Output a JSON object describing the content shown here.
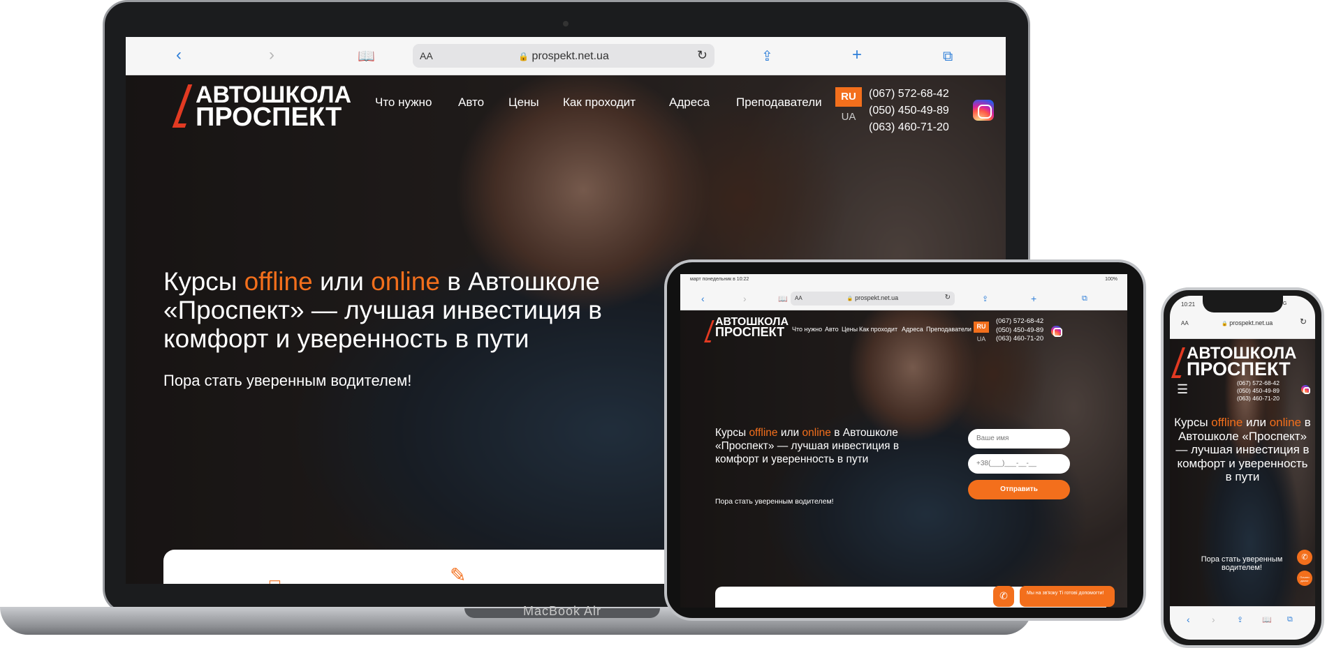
{
  "laptop": {
    "model_label": "MacBook Air",
    "browser": {
      "url": "prospekt.net.ua",
      "aa": "AA",
      "icons": [
        "back-icon",
        "forward-icon",
        "bookmarks-icon",
        "share-icon",
        "new-tab-icon",
        "tabs-icon",
        "reload-icon",
        "lock-icon"
      ]
    },
    "site": {
      "logo_line1": "АВТОШКОЛА",
      "logo_line2": "ПРОСПЕКТ",
      "nav": [
        "Что нужно",
        "Авто",
        "Цены",
        "Как проходит",
        "Адреса",
        "Преподаватели"
      ],
      "lang_active": "RU",
      "lang_other": "UA",
      "phones": [
        "(067) 572-68-42",
        "(050) 450-49-89",
        "(063) 460-71-20"
      ],
      "hero": {
        "t1": "Курсы ",
        "t2": "offline",
        "t3": " или ",
        "t4": "online",
        "t5": " в Автошколе «Проспект» — лучшая инвестиция в комфорт и уверенность в пути",
        "subtitle": "Пора стать уверенным водителем!"
      }
    }
  },
  "tablet": {
    "status_time": "март понедельник в 10:22",
    "status_right": "100%",
    "url": "prospekt.net.ua",
    "aa": "AA",
    "form": {
      "name_placeholder": "Ваше имя",
      "phone_placeholder": "+38(___)___-__-__",
      "submit": "Отправить"
    },
    "chat_text": "Мы на зв'язку Ті готові допомогти!"
  },
  "phone": {
    "time": "10:21",
    "network": "5G",
    "url": "prospekt.net.ua",
    "aa": "AA",
    "hero_subtitle": "Пора стать уверенным водителем!",
    "hero_tail": "уверенность в пути",
    "chat_fab": "Почати діалог"
  },
  "colors": {
    "accent": "#f36f1c",
    "logo_red": "#e23a22",
    "browser_blue": "#2f7fd8"
  }
}
